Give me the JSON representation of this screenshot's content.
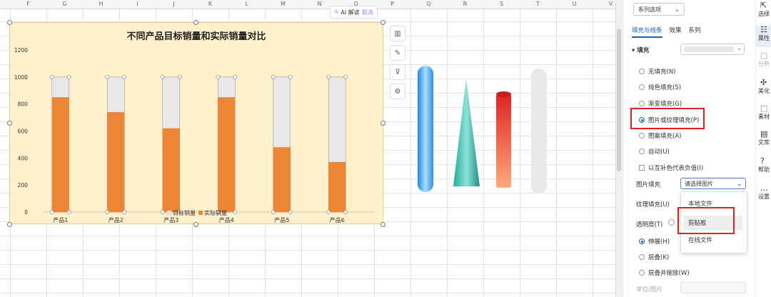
{
  "columns": [
    "F",
    "G",
    "H",
    "I",
    "J",
    "K",
    "L",
    "M",
    "N",
    "O",
    "P",
    "Q",
    "R",
    "S",
    "T",
    "U",
    "V"
  ],
  "ai_badge": {
    "label": "AI 解读",
    "close": "取消"
  },
  "chart_data": {
    "type": "bar",
    "title": "不同产品目标销量和实际销量对比",
    "categories": [
      "产品1",
      "产品2",
      "产品3",
      "产品4",
      "产品5",
      "产品6"
    ],
    "series": [
      {
        "name": "目标销量",
        "values": [
          1000,
          1000,
          1000,
          1000,
          1000,
          1000
        ],
        "color": "#e8e8e8"
      },
      {
        "name": "实际销量",
        "values": [
          850,
          740,
          620,
          850,
          480,
          370
        ],
        "color": "#ed8534"
      }
    ],
    "ylim": [
      0,
      1200
    ],
    "yticks": [
      "1200",
      "1000",
      "800",
      "600",
      "400",
      "200",
      "0"
    ],
    "legend": "bottom",
    "grid": false
  },
  "panel": {
    "series_dropdown": "系列选项",
    "tabs": [
      "填充与线条",
      "效果",
      "系列"
    ],
    "fill_section": "填充",
    "options": [
      {
        "label": "无填充(N)",
        "checked": false
      },
      {
        "label": "纯色填充(S)",
        "checked": false
      },
      {
        "label": "渐变填充(G)",
        "checked": false
      },
      {
        "label": "图片或纹理填充(P)",
        "checked": true
      },
      {
        "label": "图案填充(A)",
        "checked": false
      },
      {
        "label": "自动(U)",
        "checked": false
      }
    ],
    "invert_label": "以互补色代表负值(I)",
    "picture_fill_label": "图片填充",
    "picture_select": "请选择图片",
    "texture_fill_label": "纹理填充(U)",
    "transparency_label": "透明度(T)",
    "menu_items": [
      "本地文件",
      "剪贴板",
      "在线文件"
    ],
    "stretch_options": [
      {
        "label": "伸展(H)",
        "checked": true
      },
      {
        "label": "层叠(K)",
        "checked": false
      },
      {
        "label": "层叠并缩放(W)",
        "checked": false
      }
    ],
    "unit_label": "单位/图片"
  },
  "iconbar": [
    {
      "icon": "cursor-icon",
      "label": "选择"
    },
    {
      "icon": "properties-icon",
      "label": "属性"
    },
    {
      "icon": "analysis-icon",
      "label": "分析"
    },
    {
      "icon": "beautify-icon",
      "label": "美化"
    },
    {
      "icon": "assets-icon",
      "label": "素材"
    },
    {
      "icon": "library-icon",
      "label": "文库"
    },
    {
      "icon": "help-icon",
      "label": "帮助"
    },
    {
      "icon": "settings-icon",
      "label": "设置"
    }
  ]
}
